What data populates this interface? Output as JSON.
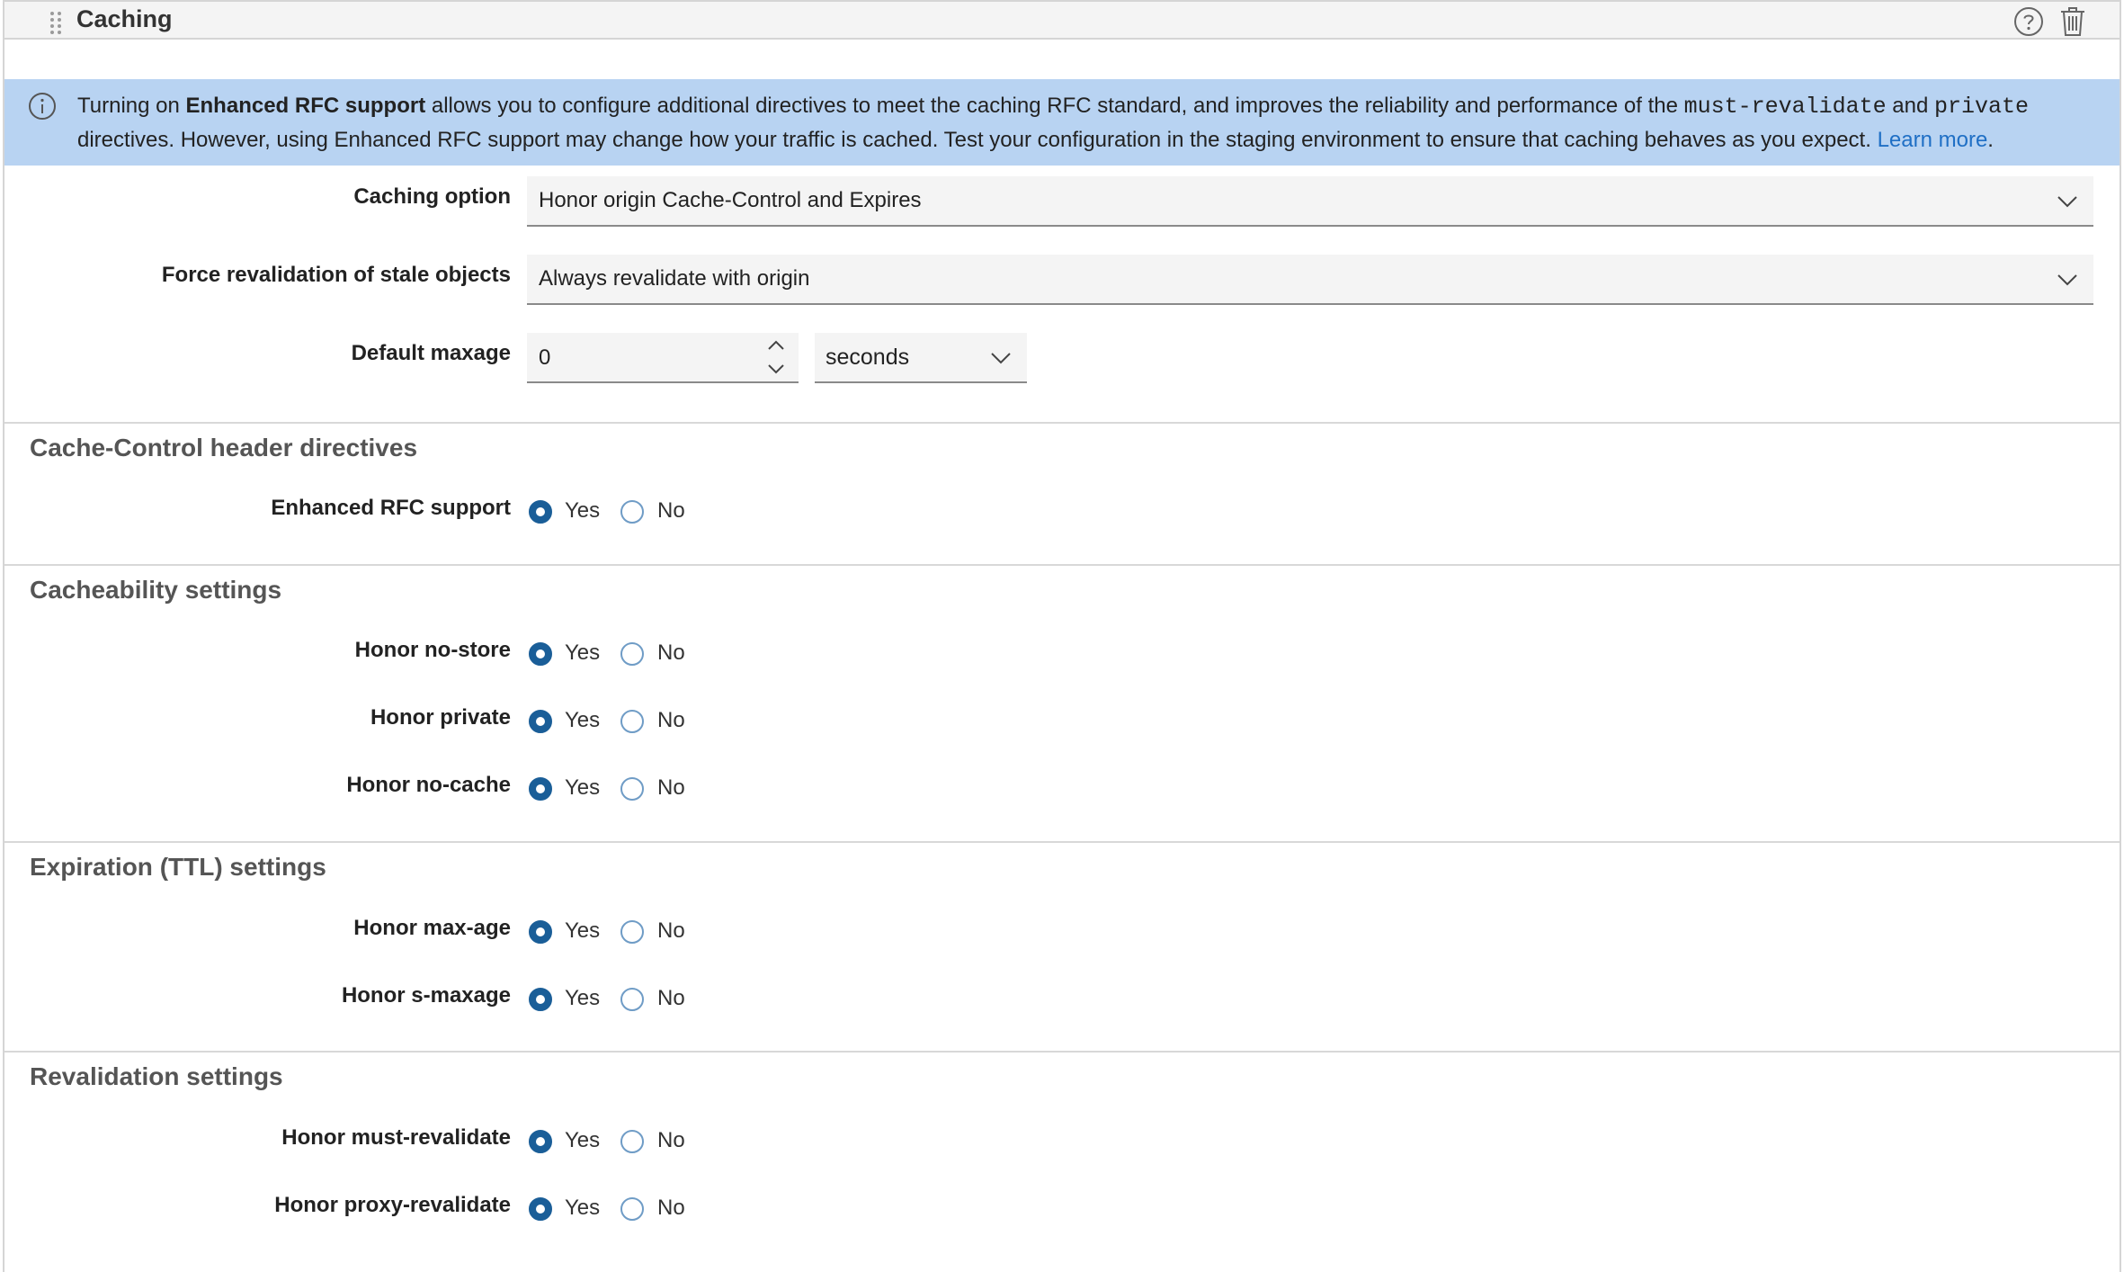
{
  "header": {
    "title": "Caching",
    "help_icon": "help-circle-icon",
    "delete_icon": "trash-icon"
  },
  "banner": {
    "icon": "info-icon",
    "p1": "Turning on ",
    "b1": "Enhanced RFC support",
    "p2": " allows you to configure additional directives to meet the caching RFC standard, and improves the reliability and performance of the ",
    "code1": "must-revalidate",
    "p3": " and ",
    "code2": "private",
    "p4": " directives. However, using Enhanced RFC support may change how your traffic is cached. Test your configuration in the staging environment to ensure that caching behaves as you expect. ",
    "link": "Learn more",
    "p5": ".",
    "color": "#b8d3f2"
  },
  "form": {
    "caching_option": {
      "label": "Caching option",
      "value": "Honor origin Cache-Control and Expires"
    },
    "force_revalidation": {
      "label": "Force revalidation of stale objects",
      "value": "Always revalidate with origin"
    },
    "default_maxage": {
      "label": "Default maxage",
      "value": "0",
      "unit": "seconds"
    }
  },
  "radio": {
    "yes": "Yes",
    "no": "No",
    "accent": "#1a5e98"
  },
  "sections": {
    "cache_control": {
      "title": "Cache-Control header directives",
      "rows": [
        {
          "label": "Enhanced RFC support",
          "selected": "Yes"
        }
      ]
    },
    "cacheability": {
      "title": "Cacheability settings",
      "rows": [
        {
          "label": "Honor no-store",
          "selected": "Yes"
        },
        {
          "label": "Honor private",
          "selected": "Yes"
        },
        {
          "label": "Honor no-cache",
          "selected": "Yes"
        }
      ]
    },
    "expiration": {
      "title": "Expiration (TTL) settings",
      "rows": [
        {
          "label": "Honor max-age",
          "selected": "Yes"
        },
        {
          "label": "Honor s-maxage",
          "selected": "Yes"
        }
      ]
    },
    "revalidation": {
      "title": "Revalidation settings",
      "rows": [
        {
          "label": "Honor must-revalidate",
          "selected": "Yes"
        },
        {
          "label": "Honor proxy-revalidate",
          "selected": "Yes"
        }
      ]
    }
  }
}
